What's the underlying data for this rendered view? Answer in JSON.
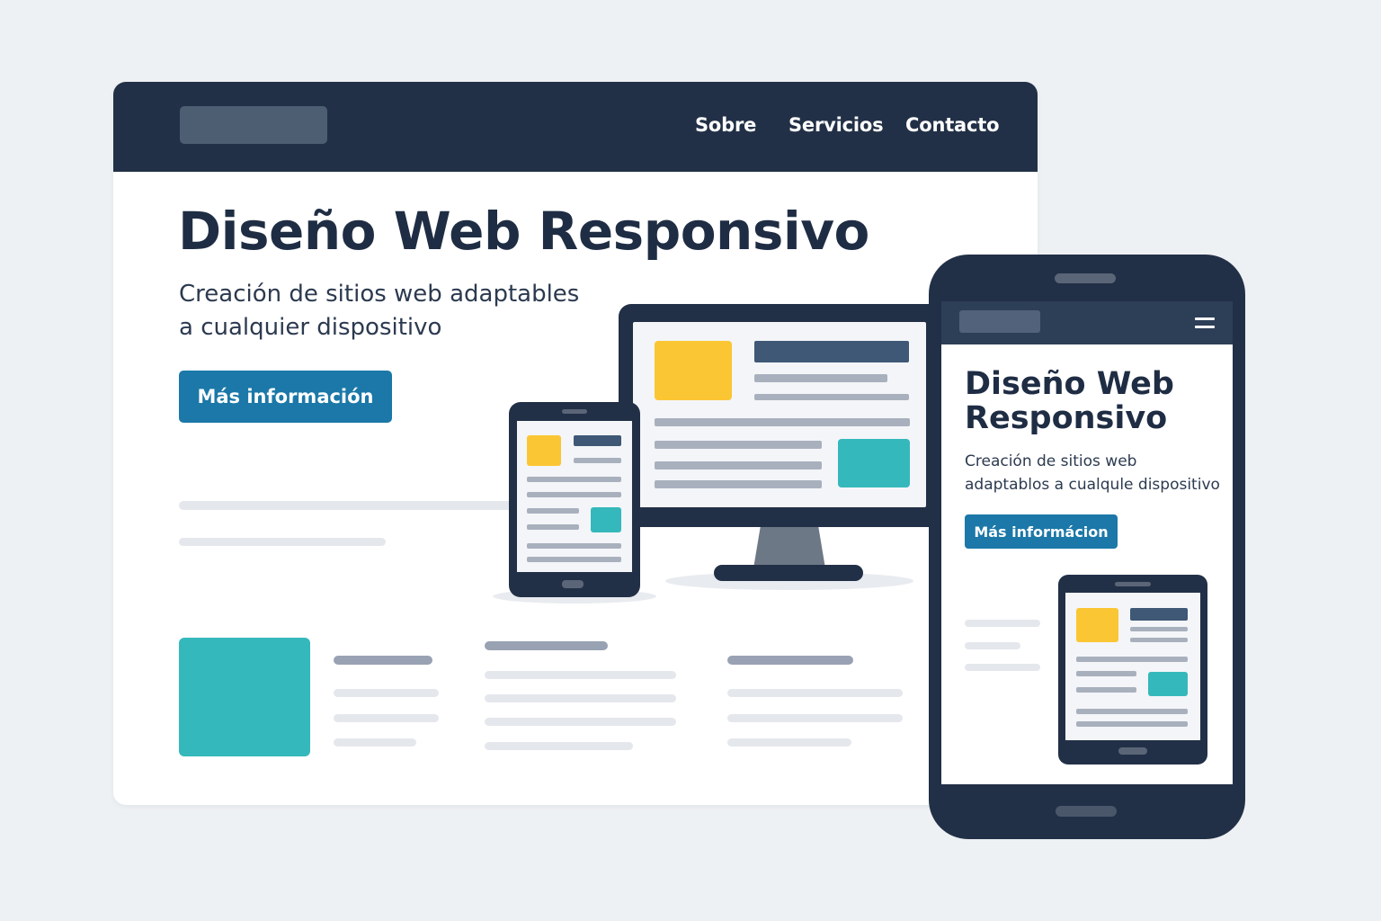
{
  "desktop": {
    "nav": [
      "Sobre",
      "Servicios",
      "Contacto"
    ],
    "hero_title": "Diseño Web Responsivo",
    "hero_subtitle_lines": [
      "Creación de sitios web adaptables",
      "a cualquier dispositivo"
    ],
    "cta_label": "Más información"
  },
  "phone": {
    "title_lines": [
      "Diseño Web",
      "Responsivo"
    ],
    "subtitle_lines": [
      "Creación de sitios web",
      "adaptablos a cualqule dispositivo"
    ],
    "cta_label": "Más informácion"
  },
  "icons": [
    "hamburger-menu-icon"
  ],
  "colors": {
    "navy": "#223047",
    "accent_blue": "#1b78a8",
    "teal": "#35b8bb",
    "yellow": "#fbc634",
    "background": "#eef1f4"
  }
}
